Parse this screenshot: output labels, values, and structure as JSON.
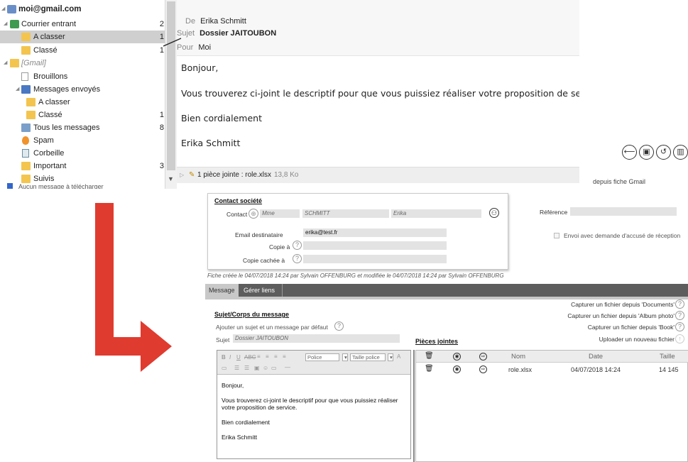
{
  "mail": {
    "account": "moi@gmail.com",
    "folders": [
      {
        "label": "Courrier entrant",
        "count": "2"
      },
      {
        "label": "A classer",
        "count": "1"
      },
      {
        "label": "Classé",
        "count": "1"
      },
      {
        "label": "[Gmail]",
        "count": ""
      },
      {
        "label": "Brouillons",
        "count": ""
      },
      {
        "label": "Messages envoyés",
        "count": ""
      },
      {
        "label": "A classer",
        "count": ""
      },
      {
        "label": "Classé",
        "count": "1"
      },
      {
        "label": "Tous les messages",
        "count": "8"
      },
      {
        "label": "Spam",
        "count": ""
      },
      {
        "label": "Corbeille",
        "count": ""
      },
      {
        "label": "Important",
        "count": "3"
      },
      {
        "label": "Suivis",
        "count": ""
      }
    ],
    "sync_status": "Aucun message à télécharger",
    "header": {
      "from_label": "De",
      "from": "Erika Schmitt",
      "subject_label": "Sujet",
      "subject": "Dossier JAITOUBON",
      "to_label": "Pour",
      "to": "Moi"
    },
    "body": [
      "Bonjour,",
      "Vous trouverez ci-joint le descriptif pour que vous puissiez réaliser votre proposition de service.",
      "Bien cordialement",
      "Erika Schmitt"
    ],
    "attachment_text": "1 pièce jointe : role.xlsx",
    "attachment_size": "13,8 Ko",
    "action_icons": [
      "reply-icon",
      "save-icon",
      "refresh-icon",
      "trash-icon"
    ]
  },
  "crm": {
    "gmail_link": "depuis fiche Gmail",
    "contact_title": "Contact société",
    "contact_label": "Contact",
    "civility": "Mme",
    "last_name": "SCHMITT",
    "first_name": "Erika",
    "reference_label": "Référence",
    "email_label": "Email destinataire",
    "email_value": "erika@test.fr",
    "cc_label": "Copie à",
    "bcc_label": "Copie cachée à",
    "receipt_label": "Envoi avec demande d'accusé de réception",
    "fiche_info": "Fiche créée le 04/07/2018 14:24 par Sylvain OFFENBURG et modifiée le 04/07/2018 14:24 par Sylvain OFFENBURG",
    "tabs": [
      "Message",
      "Gérer liens"
    ],
    "capture_links": [
      "Capturer un fichier depuis 'Documents'",
      "Capturer un fichier depuis 'Album photo'",
      "Capturer un fichier depuis 'Book'",
      "Uploader un nouveau fichier"
    ],
    "subject_section": "Sujet/Corps du message",
    "default_msg_label": "Ajouter un sujet et un message par défaut",
    "subject_label": "Sujet",
    "subject_value": "Dossier JAITOUBON",
    "attachments_title": "Pièces jointes",
    "toolbar": {
      "font": "Police",
      "font_size": "Taille police"
    },
    "editor_body": [
      "Bonjour,",
      "Vous trouverez ci-joint le descriptif pour que vous puissiez réaliser votre proposition de service.",
      "Bien cordialement",
      "Erika Schmitt"
    ],
    "att_columns": {
      "name": "Nom",
      "date": "Date",
      "size": "Taille"
    },
    "att_rows": [
      {
        "name": "role.xlsx",
        "date": "04/07/2018 14:24",
        "size": "14 145"
      }
    ]
  },
  "colors": {
    "arrow": "#e03b2f",
    "tab_bar": "#5d5d5d",
    "selected_folder": "#cfcfcf"
  }
}
